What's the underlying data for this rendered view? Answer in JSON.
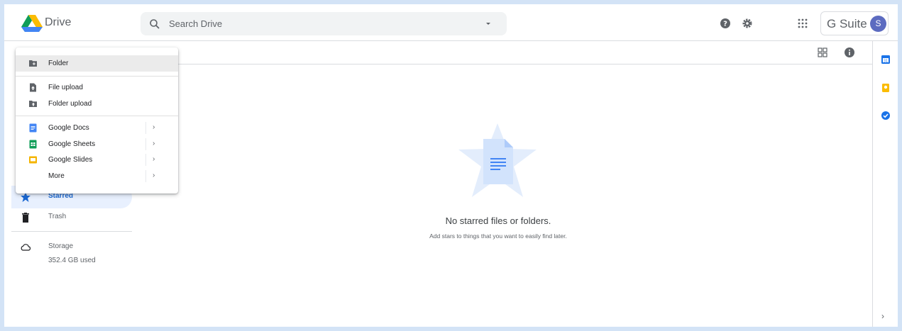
{
  "header": {
    "app_name": "Drive",
    "search_placeholder": "Search Drive",
    "brand_label": "G Suite",
    "avatar_initial": "S"
  },
  "sidebar": {
    "items": [
      {
        "label": "Starred",
        "icon": "star-icon",
        "active": true
      },
      {
        "label": "Trash",
        "icon": "trash-icon",
        "active": false
      },
      {
        "label": "Storage",
        "icon": "cloud-icon",
        "active": false
      }
    ],
    "storage_used": "352.4 GB used"
  },
  "menu": {
    "items": [
      {
        "label": "Folder",
        "icon": "new-folder-icon"
      },
      {
        "label": "File upload",
        "icon": "file-upload-icon"
      },
      {
        "label": "Folder upload",
        "icon": "folder-upload-icon"
      },
      {
        "label": "Google Docs",
        "icon": "google-docs-icon"
      },
      {
        "label": "Google Sheets",
        "icon": "google-sheets-icon"
      },
      {
        "label": "Google Slides",
        "icon": "google-slides-icon"
      },
      {
        "label": "More",
        "icon": ""
      }
    ]
  },
  "empty_state": {
    "title": "No starred files or folders.",
    "subtitle": "Add stars to things that you want to easily find later."
  },
  "colors": {
    "accent": "#1967d2",
    "docs": "#4285f4",
    "sheets": "#0f9d58",
    "slides": "#f4b400"
  }
}
